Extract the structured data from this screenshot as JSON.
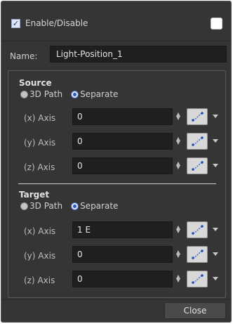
{
  "enable": {
    "label": "Enable/Disable",
    "checked": true
  },
  "color_swatch": {
    "color": "#ffffff"
  },
  "name": {
    "label": "Name:",
    "value": "Light-Position_1"
  },
  "source": {
    "title": "Source",
    "mode_options": [
      "3D Path",
      "Separate"
    ],
    "selected_mode": "Separate",
    "axes": [
      {
        "label": "(x) Axis",
        "value": "0"
      },
      {
        "label": "(y) Axis",
        "value": "0"
      },
      {
        "label": "(z) Axis",
        "value": "0"
      }
    ]
  },
  "target": {
    "title": "Target",
    "mode_options": [
      "3D Path",
      "Separate"
    ],
    "selected_mode": "Separate",
    "axes": [
      {
        "label": "(x) Axis",
        "value": "1 E"
      },
      {
        "label": "(y) Axis",
        "value": "0"
      },
      {
        "label": "(z) Axis",
        "value": "0"
      }
    ]
  },
  "footer": {
    "close_label": "Close"
  },
  "icons": {
    "spinner": "up-down-spinner-icon",
    "function": "function-curve-icon",
    "dropdown": "chevron-down-icon"
  }
}
